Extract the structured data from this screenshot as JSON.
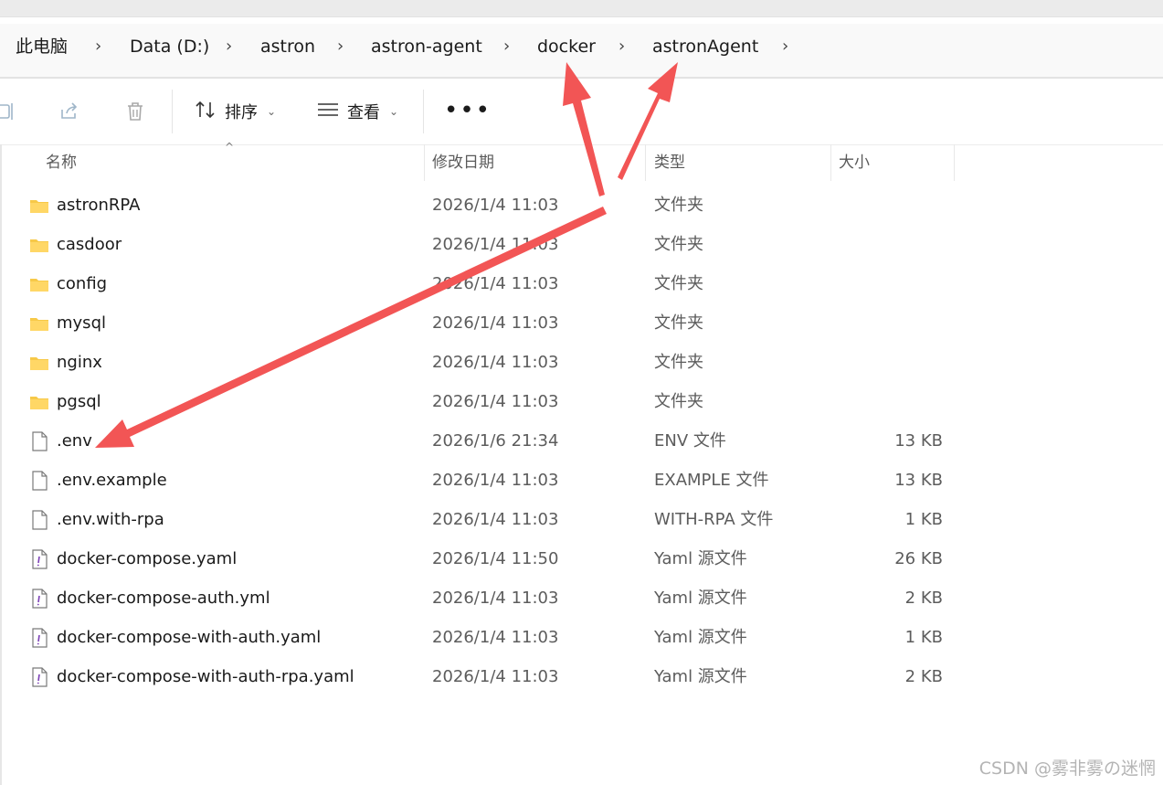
{
  "breadcrumb": {
    "items": [
      "此电脑",
      "Data (D:)",
      "astron",
      "astron-agent",
      "docker",
      "astronAgent"
    ]
  },
  "toolbar": {
    "sort_label": "排序",
    "view_label": "查看",
    "more_label": "•••"
  },
  "columns": {
    "name": "名称",
    "date": "修改日期",
    "type": "类型",
    "size": "大小"
  },
  "files": [
    {
      "name": "astronRPA",
      "date": "2026/1/4 11:03",
      "type": "文件夹",
      "size": "",
      "icon": "folder-icon"
    },
    {
      "name": "casdoor",
      "date": "2026/1/4 11:03",
      "type": "文件夹",
      "size": "",
      "icon": "folder-icon"
    },
    {
      "name": "config",
      "date": "2026/1/4 11:03",
      "type": "文件夹",
      "size": "",
      "icon": "folder-icon"
    },
    {
      "name": "mysql",
      "date": "2026/1/4 11:03",
      "type": "文件夹",
      "size": "",
      "icon": "folder-icon"
    },
    {
      "name": "nginx",
      "date": "2026/1/4 11:03",
      "type": "文件夹",
      "size": "",
      "icon": "folder-icon"
    },
    {
      "name": "pgsql",
      "date": "2026/1/4 11:03",
      "type": "文件夹",
      "size": "",
      "icon": "folder-icon"
    },
    {
      "name": ".env",
      "date": "2026/1/6 21:34",
      "type": "ENV 文件",
      "size": "13 KB",
      "icon": "file-icon"
    },
    {
      "name": ".env.example",
      "date": "2026/1/4 11:03",
      "type": "EXAMPLE 文件",
      "size": "13 KB",
      "icon": "file-icon"
    },
    {
      "name": ".env.with-rpa",
      "date": "2026/1/4 11:03",
      "type": "WITH-RPA 文件",
      "size": "1 KB",
      "icon": "file-icon"
    },
    {
      "name": "docker-compose.yaml",
      "date": "2026/1/4 11:50",
      "type": "Yaml 源文件",
      "size": "26 KB",
      "icon": "yaml-file-icon"
    },
    {
      "name": "docker-compose-auth.yml",
      "date": "2026/1/4 11:03",
      "type": "Yaml 源文件",
      "size": "2 KB",
      "icon": "yaml-file-icon"
    },
    {
      "name": "docker-compose-with-auth.yaml",
      "date": "2026/1/4 11:03",
      "type": "Yaml 源文件",
      "size": "1 KB",
      "icon": "yaml-file-icon"
    },
    {
      "name": "docker-compose-with-auth-rpa.yaml",
      "date": "2026/1/4 11:03",
      "type": "Yaml 源文件",
      "size": "2 KB",
      "icon": "yaml-file-icon"
    }
  ],
  "watermark": "CSDN @雾非雾の迷惘",
  "colors": {
    "annotation_arrow": "#f25555",
    "folder": "#f7c948"
  }
}
